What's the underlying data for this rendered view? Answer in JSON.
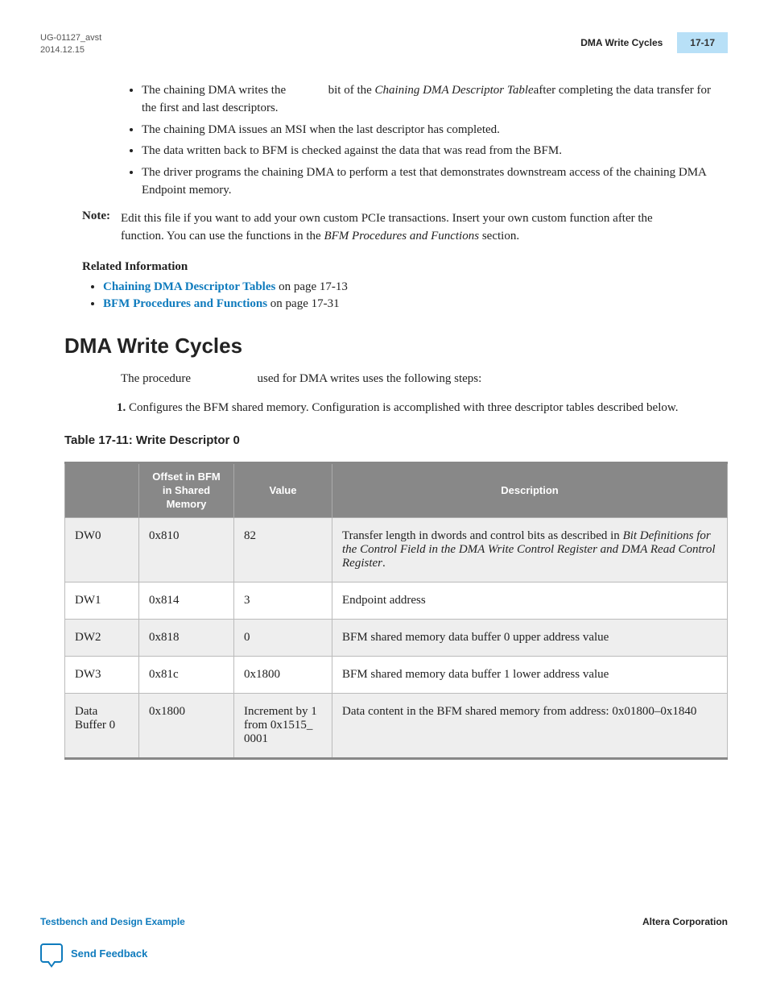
{
  "header": {
    "doc_id": "UG-01127_avst",
    "date": "2014.12.15",
    "section_title": "DMA Write Cycles",
    "page_number": "17-17"
  },
  "bullets": {
    "b1a": "The chaining DMA writes the ",
    "b1b": " bit of the ",
    "b1c": "Chaining DMA Descriptor Table",
    "b1d": "after completing the data transfer for the first and last descriptors.",
    "b2": "The chaining DMA issues an MSI when the last descriptor has completed.",
    "b3": "The data written back to BFM is checked against the data that was read from the BFM.",
    "b4": "The driver programs the chaining DMA to perform a test that demonstrates downstream access of the chaining DMA Endpoint memory."
  },
  "note": {
    "label": "Note:",
    "p1": "Edit this file if you want to add your own custom PCIe transactions. Insert your own custom function after the ",
    "p2": " function. You can use the functions in the ",
    "p3": "BFM Procedures and Functions",
    "p4": " section."
  },
  "related": {
    "heading": "Related Information",
    "link1_text": "Chaining DMA Descriptor Tables",
    "link1_suffix": " on page 17-13",
    "link2_text": "BFM Procedures and Functions",
    "link2_suffix": " on page 17-31"
  },
  "section": {
    "h1": "DMA Write Cycles",
    "intro_a": "The procedure ",
    "intro_b": " used for DMA writes uses the following steps:",
    "step1": "Configures the BFM shared memory. Configuration is accomplished with three descriptor tables described below."
  },
  "table": {
    "caption": "Table 17-11: Write Descriptor 0",
    "headers": {
      "h1": "",
      "h2": "Offset in BFM in Shared Memory",
      "h3": "Value",
      "h4": "Description"
    },
    "rows": [
      {
        "c1": "DW0",
        "c2": "0x810",
        "c3": "82",
        "c4a": "Transfer length in dwords and control bits as described in ",
        "c4b": "Bit Definitions for the Control Field in the DMA Write Control Register and DMA Read Control Register",
        "c4c": "."
      },
      {
        "c1": "DW1",
        "c2": "0x814",
        "c3": "3",
        "c4a": "Endpoint address",
        "c4b": "",
        "c4c": ""
      },
      {
        "c1": "DW2",
        "c2": "0x818",
        "c3": "0",
        "c4a": "BFM shared memory data buffer 0 upper address value",
        "c4b": "",
        "c4c": ""
      },
      {
        "c1": "DW3",
        "c2": "0x81c",
        "c3": "0x1800",
        "c4a": "BFM shared memory data buffer 1 lower address value",
        "c4b": "",
        "c4c": ""
      },
      {
        "c1": "Data Buffer 0",
        "c2": "0x1800",
        "c3": "Increment by 1 from 0x1515_ 0001",
        "c4a": "Data content in the BFM shared memory from address: 0x01800–0x1840",
        "c4b": "",
        "c4c": ""
      }
    ]
  },
  "footer": {
    "left": "Testbench and Design Example",
    "right": "Altera Corporation",
    "feedback": "Send Feedback"
  }
}
